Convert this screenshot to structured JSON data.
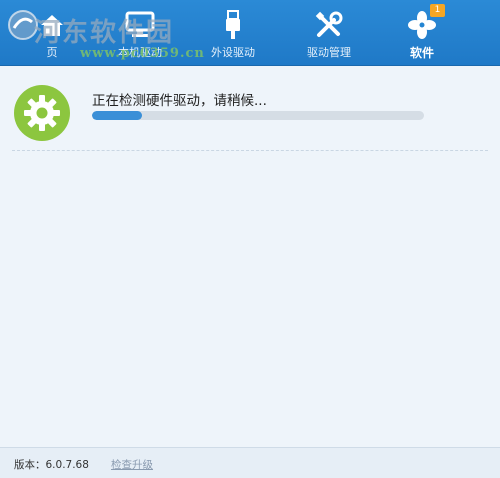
{
  "nav": {
    "items": [
      {
        "label": "页",
        "icon": "home-icon"
      },
      {
        "label": "本机驱动",
        "icon": "monitor-icon"
      },
      {
        "label": "外设驱动",
        "icon": "usb-icon"
      },
      {
        "label": "驱动管理",
        "icon": "tools-icon"
      },
      {
        "label": "软件",
        "icon": "fan-icon",
        "badge": "1",
        "active": true
      }
    ]
  },
  "watermark": {
    "title": "河东软件园",
    "url": "www.pc0359.cn"
  },
  "main": {
    "status_text": "正在检测硬件驱动，请稍候...",
    "progress": 0.15
  },
  "footer": {
    "version": "版本：6.0.7.68",
    "upgrade_link": "检查升级"
  },
  "colors": {
    "topbar": "#2485d2",
    "gear": "#8cc63f",
    "progress_fill": "#3a8fd7",
    "badge": "#f5a623"
  }
}
